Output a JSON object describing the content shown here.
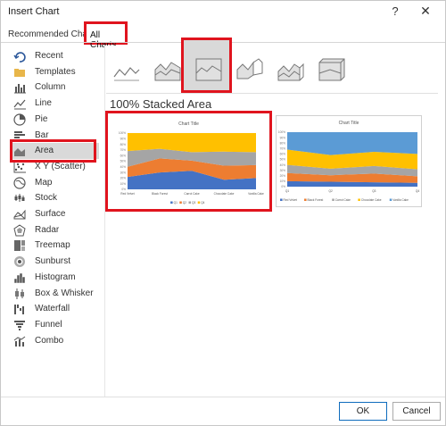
{
  "window": {
    "title": "Insert Chart",
    "help_icon": "?",
    "close_icon": "✕"
  },
  "tabs": {
    "recommended": "Recommended Charts",
    "all": "All Charts"
  },
  "sidebar": {
    "items": [
      {
        "label": "Recent",
        "icon": "recent-icon"
      },
      {
        "label": "Templates",
        "icon": "folder-icon"
      },
      {
        "label": "Column",
        "icon": "column-chart-icon"
      },
      {
        "label": "Line",
        "icon": "line-chart-icon"
      },
      {
        "label": "Pie",
        "icon": "pie-chart-icon"
      },
      {
        "label": "Bar",
        "icon": "bar-chart-icon"
      },
      {
        "label": "Area",
        "icon": "area-chart-icon",
        "selected": true
      },
      {
        "label": "X Y (Scatter)",
        "icon": "scatter-chart-icon"
      },
      {
        "label": "Map",
        "icon": "map-chart-icon"
      },
      {
        "label": "Stock",
        "icon": "stock-chart-icon"
      },
      {
        "label": "Surface",
        "icon": "surface-chart-icon"
      },
      {
        "label": "Radar",
        "icon": "radar-chart-icon"
      },
      {
        "label": "Treemap",
        "icon": "treemap-chart-icon"
      },
      {
        "label": "Sunburst",
        "icon": "sunburst-chart-icon"
      },
      {
        "label": "Histogram",
        "icon": "histogram-chart-icon"
      },
      {
        "label": "Box & Whisker",
        "icon": "box-whisker-chart-icon"
      },
      {
        "label": "Waterfall",
        "icon": "waterfall-chart-icon"
      },
      {
        "label": "Funnel",
        "icon": "funnel-chart-icon"
      },
      {
        "label": "Combo",
        "icon": "combo-chart-icon"
      }
    ]
  },
  "subtypes": [
    "area-icon",
    "stacked-area-icon",
    "100-stacked-area-icon",
    "3d-area-icon",
    "3d-stacked-area-icon",
    "3d-100-stacked-area-icon"
  ],
  "section_title": "100% Stacked Area",
  "buttons": {
    "ok": "OK",
    "cancel": "Cancel"
  },
  "colors": {
    "highlight": "#e0141e",
    "s1": "#4472c4",
    "s2": "#ed7d31",
    "s3": "#a5a5a5",
    "s4": "#ffc000",
    "s5": "#5b9bd5"
  },
  "chart_data": [
    {
      "type": "area",
      "stacked": "percent",
      "title": "Chart Title",
      "categories": [
        "Red Velvet",
        "Black Forest",
        "Carrot Cake",
        "Chocolate Cake",
        "Vanilla Cake"
      ],
      "y_ticks": [
        "0%",
        "10%",
        "20%",
        "30%",
        "40%",
        "50%",
        "60%",
        "70%",
        "80%",
        "90%",
        "100%"
      ],
      "series": [
        {
          "name": "Q1",
          "values": [
            22,
            30,
            33,
            17,
            20
          ]
        },
        {
          "name": "Q2",
          "values": [
            18,
            25,
            18,
            25,
            23
          ]
        },
        {
          "name": "Q3",
          "values": [
            28,
            17,
            15,
            25,
            23
          ]
        },
        {
          "name": "Q4",
          "values": [
            32,
            28,
            34,
            33,
            34
          ]
        }
      ],
      "legend": "bottom"
    },
    {
      "type": "area",
      "stacked": "percent",
      "title": "Chart Title",
      "categories": [
        "Q1",
        "Q2",
        "Q3",
        "Q4"
      ],
      "y_ticks": [
        "0%",
        "10%",
        "20%",
        "30%",
        "40%",
        "50%",
        "60%",
        "70%",
        "80%",
        "90%",
        "100%"
      ],
      "series": [
        {
          "name": "Red Velvet",
          "values": [
            10,
            9,
            8,
            7
          ]
        },
        {
          "name": "Black Forest",
          "values": [
            15,
            12,
            16,
            12
          ]
        },
        {
          "name": "Carrot Cake",
          "values": [
            15,
            12,
            14,
            13
          ]
        },
        {
          "name": "Chocolate Cake",
          "values": [
            28,
            25,
            26,
            28
          ]
        },
        {
          "name": "Vanilla Cake",
          "values": [
            32,
            42,
            36,
            40
          ]
        }
      ],
      "legend": "bottom"
    }
  ]
}
